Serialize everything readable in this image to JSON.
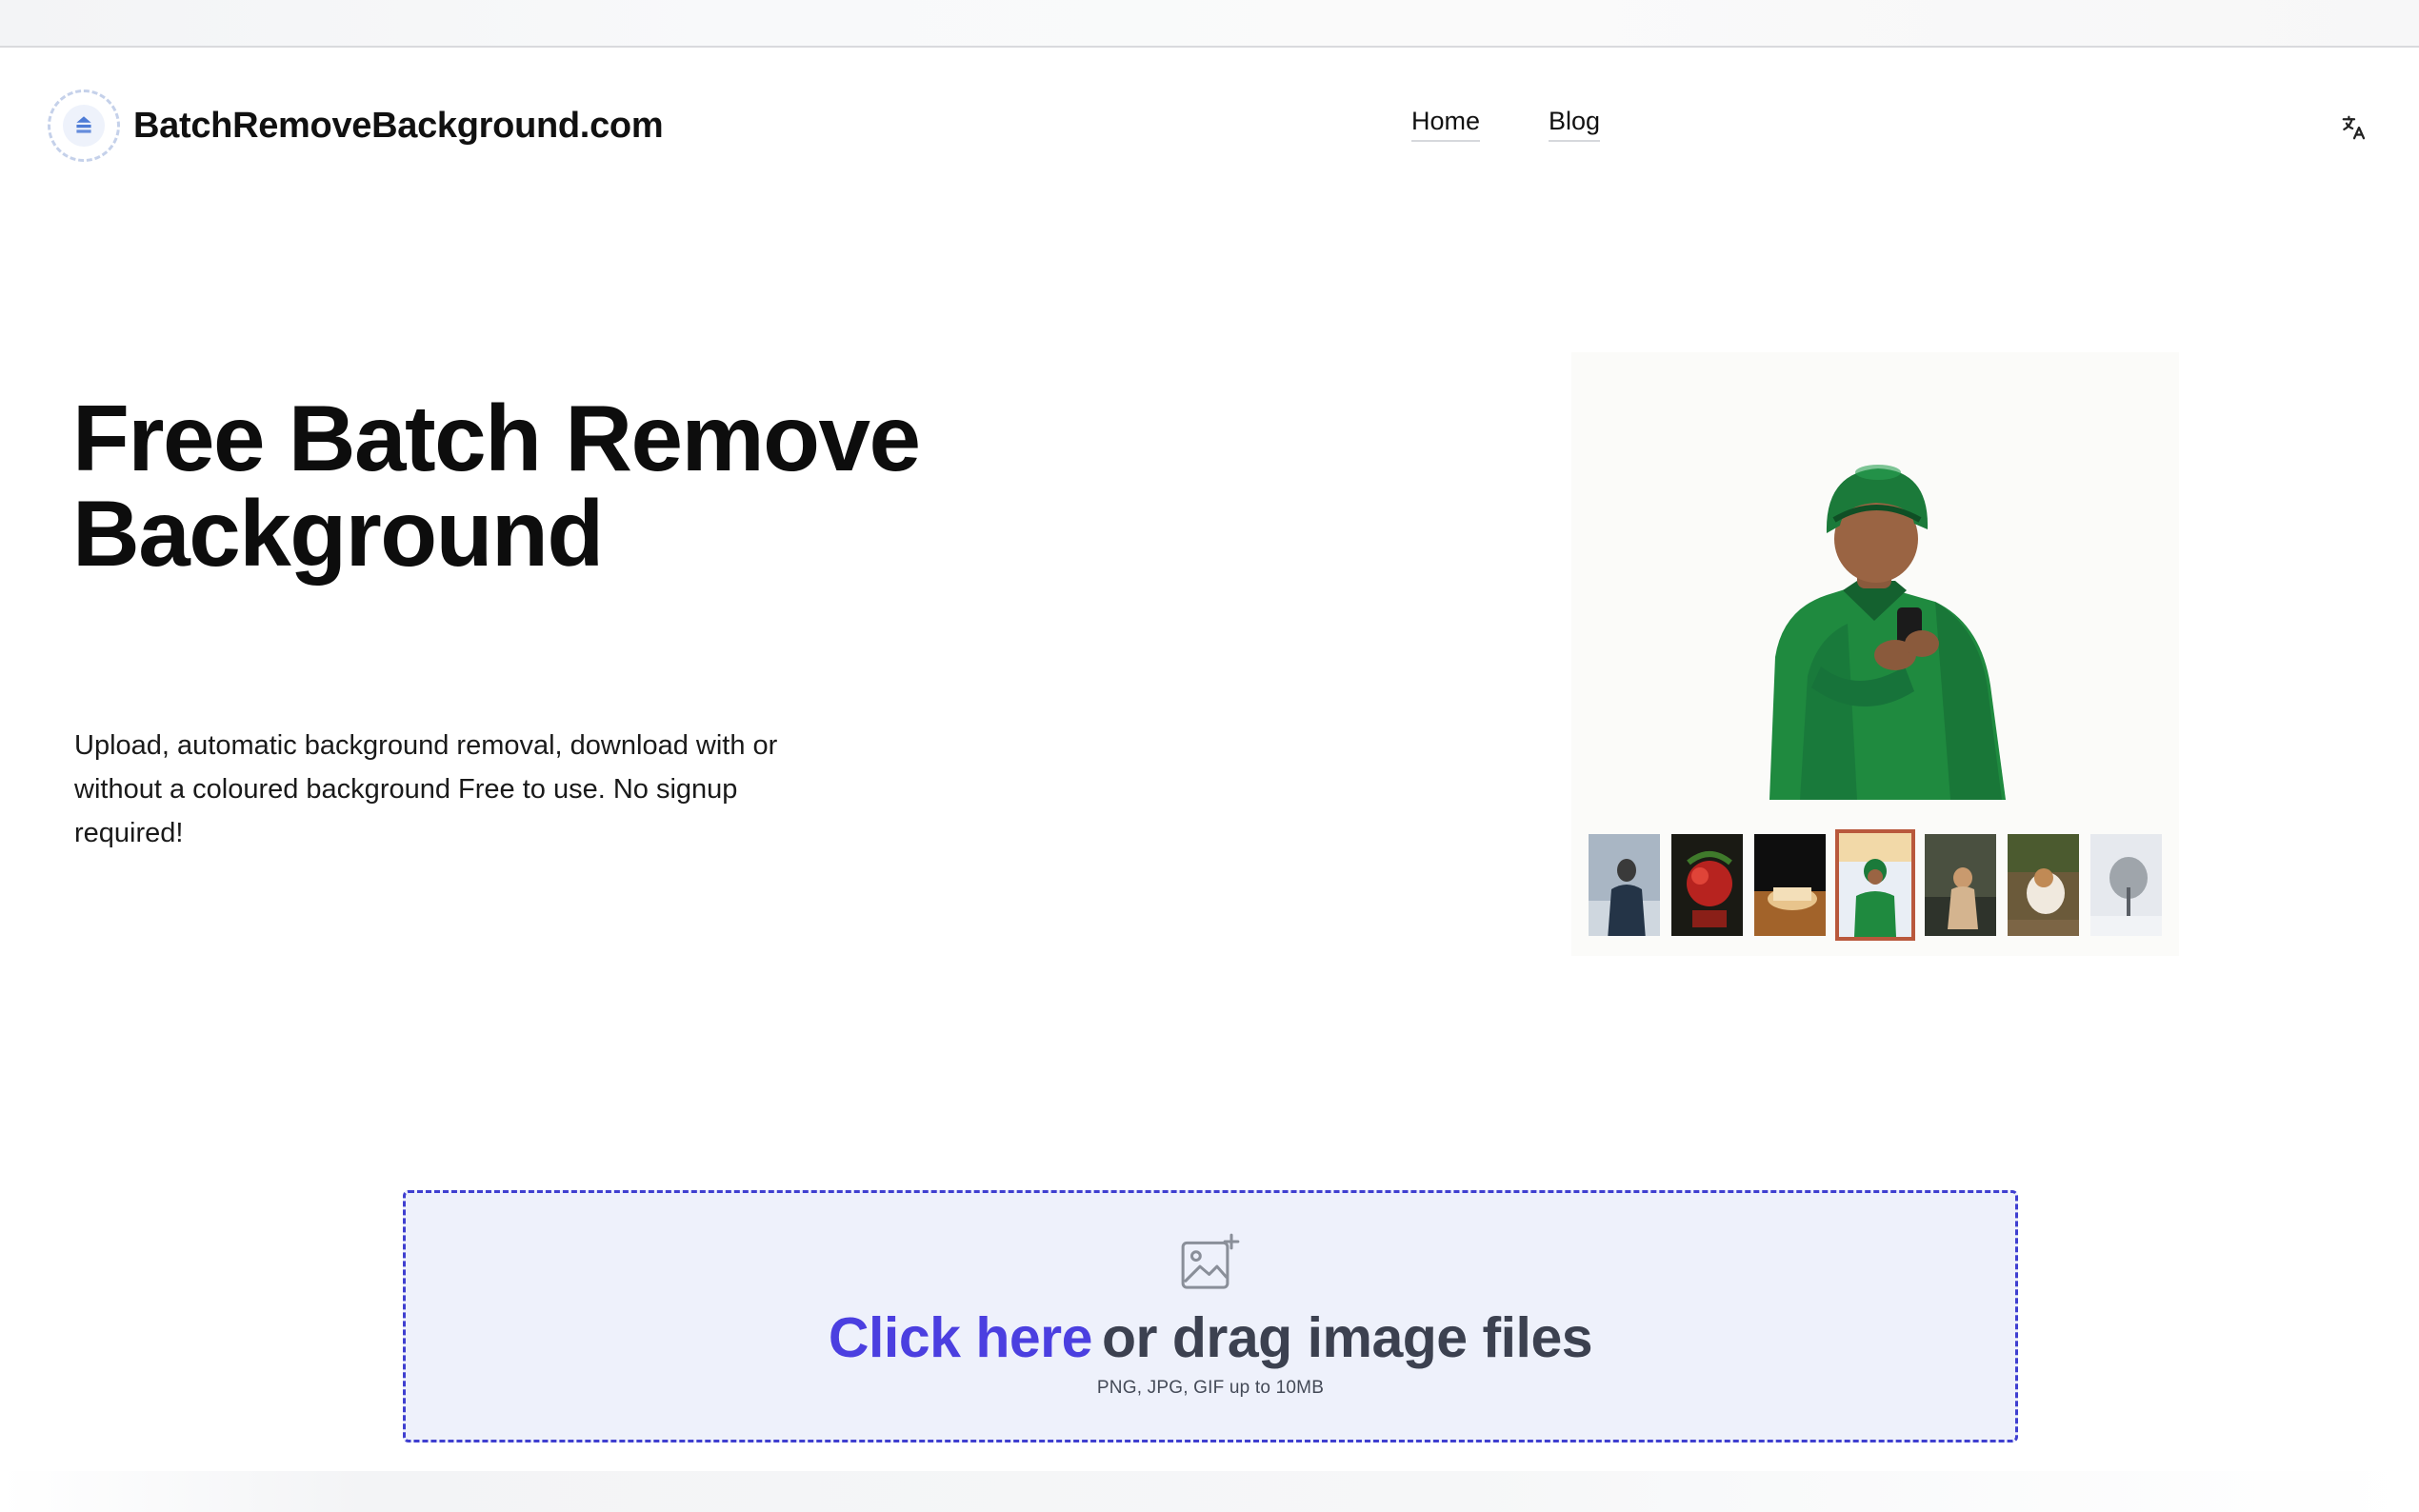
{
  "header": {
    "brand": "BatchRemoveBackground.com",
    "logo_icon": "layers-icon",
    "nav": [
      {
        "label": "Home"
      },
      {
        "label": "Blog"
      }
    ],
    "language_icon": "translate-icon"
  },
  "hero": {
    "title": "Free Batch Remove Background",
    "description": "Upload, automatic background removal, download with or without a coloured background Free to use. No signup required!"
  },
  "showcase": {
    "thumbnails_count": 7,
    "selected_index": 3
  },
  "upload": {
    "click_text": "Click here",
    "drag_text": "or drag image files",
    "hint": "PNG, JPG, GIF up to 10MB",
    "icon": "image-add-icon"
  },
  "colors": {
    "accent": "#4b3fe0",
    "dropzone_bg": "#eef1fb",
    "dropzone_border": "#3f3fd0",
    "selected_thumb_border": "#b9583c"
  }
}
